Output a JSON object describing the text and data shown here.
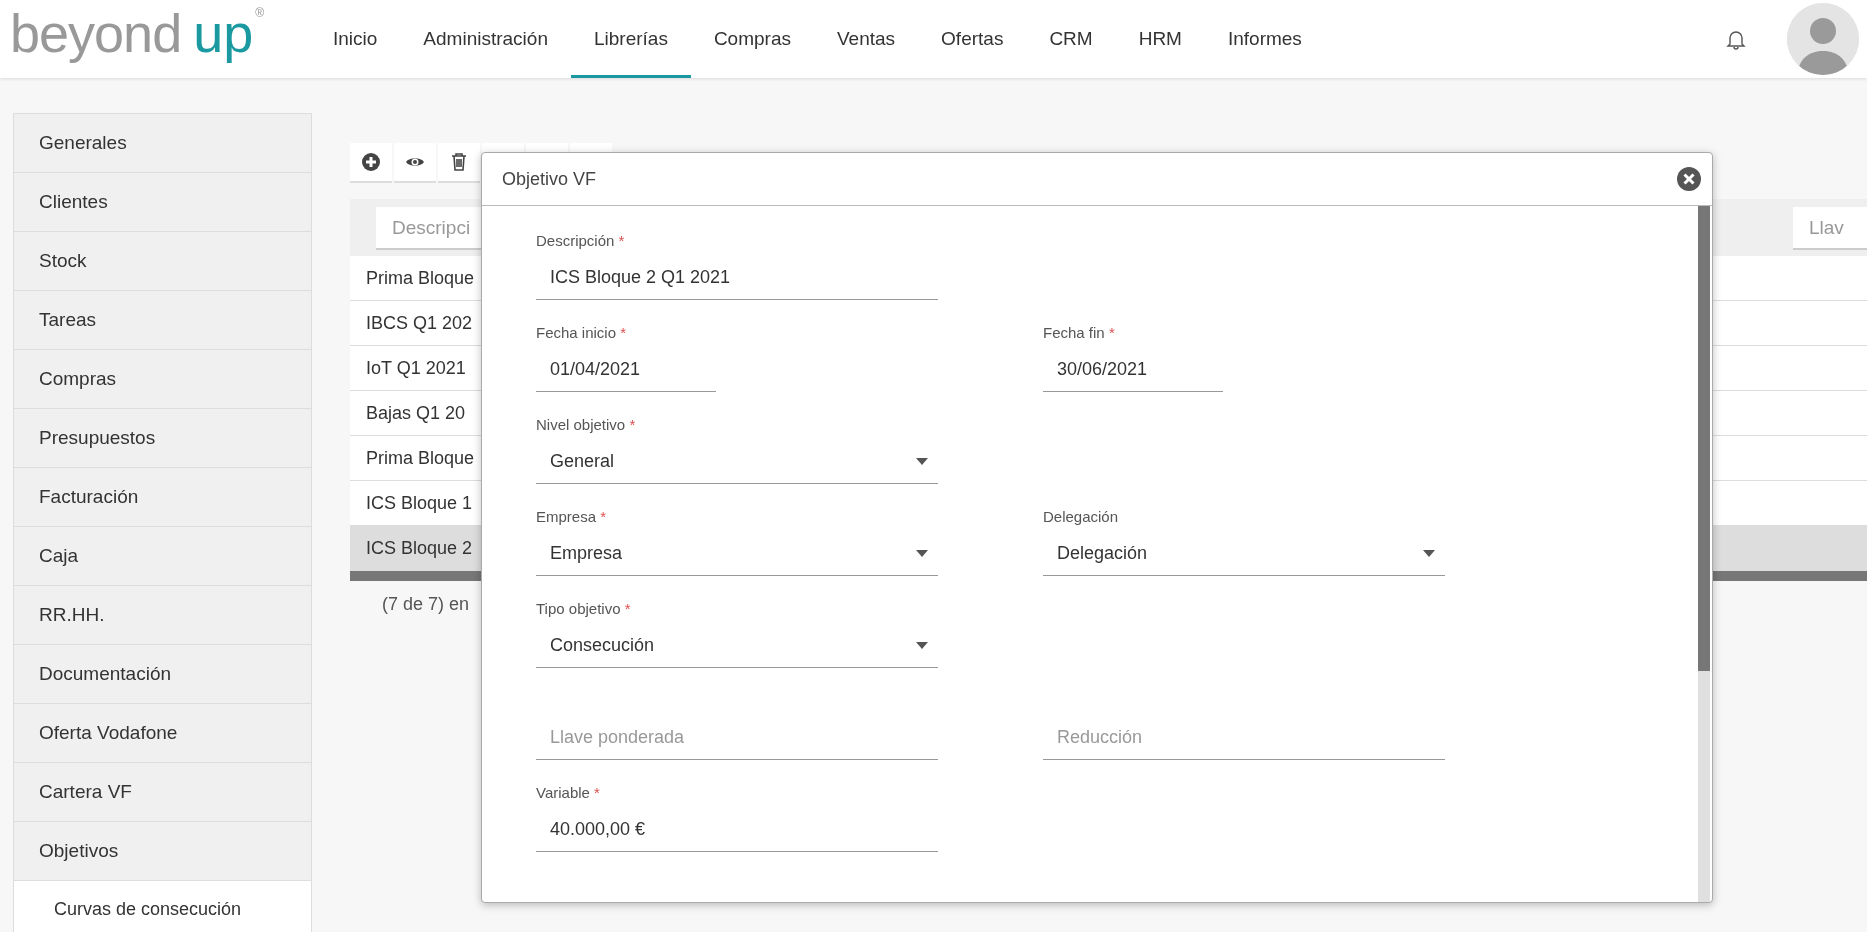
{
  "header": {
    "logo": {
      "word": "beyond",
      "accent": "up",
      "mark": "®"
    },
    "nav": [
      {
        "label": "Inicio",
        "selected": false
      },
      {
        "label": "Administración",
        "selected": false
      },
      {
        "label": "Librerías",
        "selected": true
      },
      {
        "label": "Compras",
        "selected": false
      },
      {
        "label": "Ventas",
        "selected": false
      },
      {
        "label": "Ofertas",
        "selected": false
      },
      {
        "label": "CRM",
        "selected": false
      },
      {
        "label": "HRM",
        "selected": false
      },
      {
        "label": "Informes",
        "selected": false
      }
    ]
  },
  "sidebar": {
    "items": [
      {
        "label": "Generales"
      },
      {
        "label": "Clientes"
      },
      {
        "label": "Stock"
      },
      {
        "label": "Tareas"
      },
      {
        "label": "Compras"
      },
      {
        "label": "Presupuestos"
      },
      {
        "label": "Facturación"
      },
      {
        "label": "Caja"
      },
      {
        "label": "RR.HH."
      },
      {
        "label": "Documentación"
      },
      {
        "label": "Oferta Vodafone"
      },
      {
        "label": "Cartera VF"
      },
      {
        "label": "Objetivos",
        "children": [
          {
            "label": "Curvas de consecución"
          }
        ]
      }
    ]
  },
  "toolbar": [
    {
      "kind": "add"
    },
    {
      "kind": "view"
    },
    {
      "kind": "delete"
    },
    {
      "kind": "blank"
    },
    {
      "kind": "blank"
    },
    {
      "kind": "blank"
    }
  ],
  "table": {
    "filters": [
      {
        "placeholder": "Descripci"
      },
      {
        "placeholder": "Llav"
      }
    ],
    "rows": [
      {
        "cell": "Prima Bloque",
        "selected": false
      },
      {
        "cell": "IBCS Q1 202",
        "selected": false
      },
      {
        "cell": "IoT Q1 2021",
        "selected": false
      },
      {
        "cell": "Bajas Q1 20",
        "selected": false
      },
      {
        "cell": "Prima Bloque",
        "selected": false
      },
      {
        "cell": "ICS Bloque 1",
        "selected": false
      },
      {
        "cell": "ICS Bloque 2",
        "selected": true
      }
    ],
    "footer": "(7 de 7) en"
  },
  "dialog": {
    "title": "Objetivo VF",
    "rows": [
      [
        {
          "kind": "text",
          "label": "Descripción",
          "required_mark": "*",
          "value": "ICS Bloque 2 Q1 2021"
        }
      ],
      [
        {
          "kind": "date",
          "label": "Fecha inicio",
          "required_mark": "*",
          "value": "01/04/2021"
        },
        {
          "kind": "date",
          "label": "Fecha fin",
          "required_mark": "*",
          "value": "30/06/2021"
        }
      ],
      [
        {
          "kind": "select",
          "label": "Nivel objetivo",
          "required_mark": "*",
          "value": "General"
        }
      ],
      [
        {
          "kind": "select",
          "label": "Empresa",
          "required_mark": "*",
          "value": "Empresa"
        },
        {
          "kind": "select",
          "label": "Delegación",
          "value": "Delegación"
        }
      ],
      [
        {
          "kind": "select",
          "label": "Tipo objetivo",
          "required_mark": "*",
          "value": "Consecución"
        }
      ],
      [
        {
          "kind": "text",
          "placeholder": "Llave ponderada"
        },
        {
          "kind": "text",
          "placeholder": "Reducción"
        }
      ],
      [
        {
          "kind": "text",
          "label": "Variable",
          "required_mark": "*",
          "value": "40.000,00 €"
        }
      ]
    ]
  }
}
